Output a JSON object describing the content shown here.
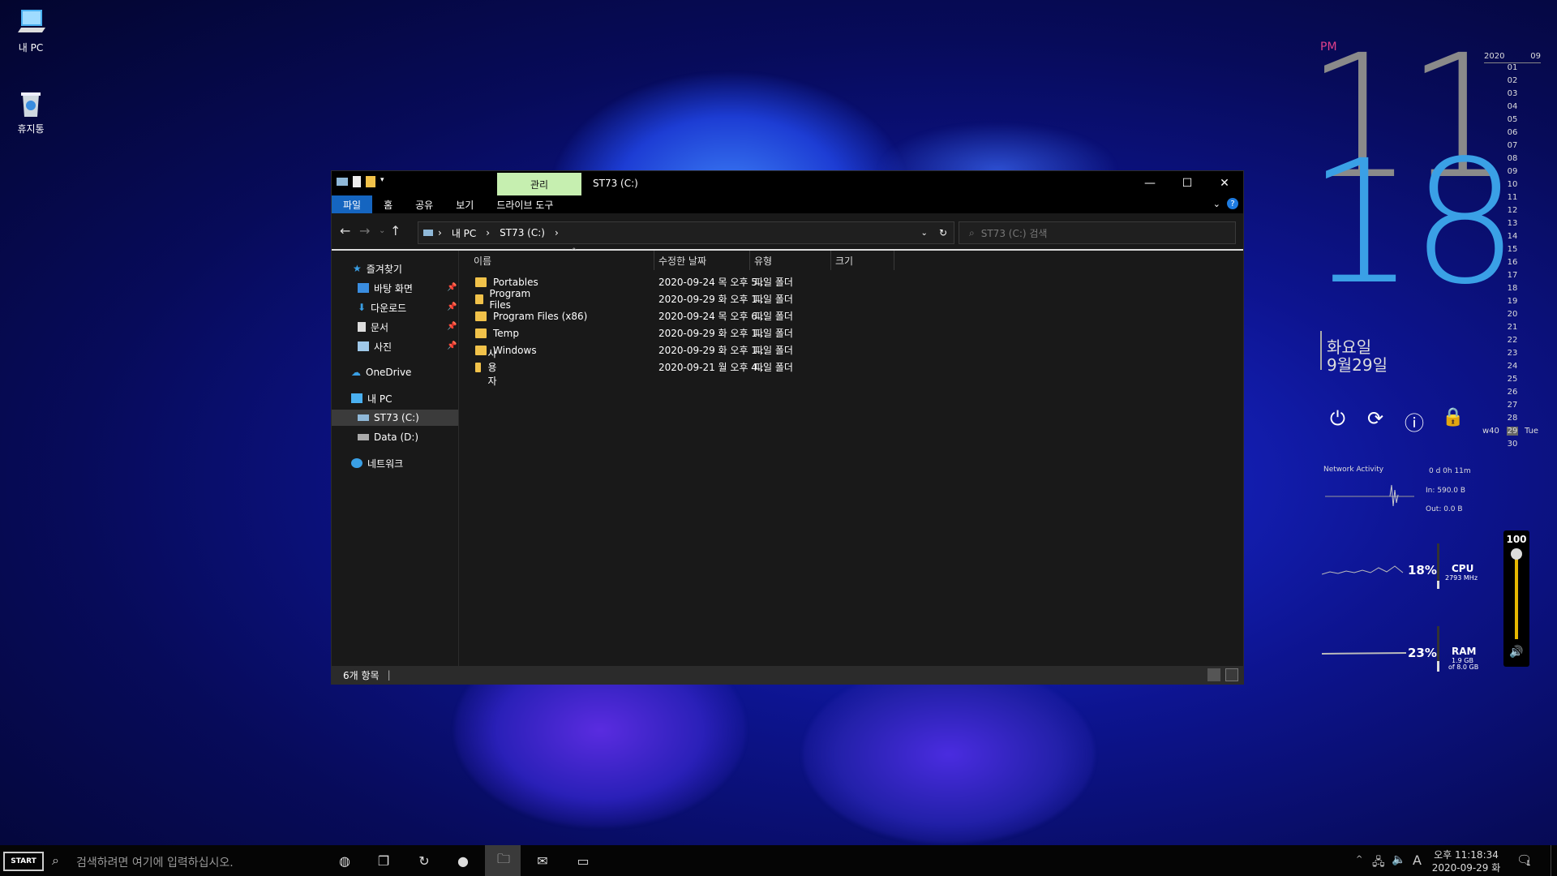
{
  "desktop": {
    "icons": [
      {
        "label": "내 PC",
        "icon": "computer-icon"
      },
      {
        "label": "휴지통",
        "icon": "recycle-bin-icon"
      }
    ]
  },
  "explorer": {
    "title": "ST73 (C:)",
    "context_tab": "관리",
    "ribbon_tabs": [
      "파일",
      "홈",
      "공유",
      "보기",
      "드라이브 도구"
    ],
    "address": {
      "crumbs": [
        "내 PC",
        "ST73 (C:)"
      ]
    },
    "search_placeholder": "ST73 (C:) 검색",
    "nav": {
      "quick_access": "즐겨찾기",
      "pinned": [
        "바탕 화면",
        "다운로드",
        "문서",
        "사진"
      ],
      "onedrive": "OneDrive",
      "this_pc": "내 PC",
      "drives": [
        "ST73 (C:)",
        "Data (D:)"
      ],
      "network": "네트워크"
    },
    "columns": [
      "이름",
      "수정한 날짜",
      "유형",
      "크기"
    ],
    "rows": [
      {
        "name": "Portables",
        "date": "2020-09-24 목 오후 5...",
        "type": "파일 폴더"
      },
      {
        "name": "Program Files",
        "date": "2020-09-29 화 오후 1...",
        "type": "파일 폴더"
      },
      {
        "name": "Program Files (x86)",
        "date": "2020-09-24 목 오후 6...",
        "type": "파일 폴더"
      },
      {
        "name": "Temp",
        "date": "2020-09-29 화 오후 1...",
        "type": "파일 폴더"
      },
      {
        "name": "Windows",
        "date": "2020-09-29 화 오후 1...",
        "type": "파일 폴더"
      },
      {
        "name": "사용자",
        "date": "2020-09-21 월 오후 4...",
        "type": "파일 폴더"
      }
    ],
    "status": "6개 항목"
  },
  "clock": {
    "ampm": "PM",
    "hour": "11",
    "minute": "18",
    "weekday": "화요일",
    "date": "9월29일"
  },
  "calendar": {
    "year": "2020",
    "month": "09",
    "days": [
      "01",
      "02",
      "03",
      "04",
      "05",
      "06",
      "07",
      "08",
      "09",
      "10",
      "11",
      "12",
      "13",
      "14",
      "15",
      "16",
      "17",
      "18",
      "19",
      "20",
      "21",
      "22",
      "23",
      "24",
      "25",
      "26",
      "27",
      "28",
      "29",
      "30"
    ],
    "week": "w40",
    "today": "29",
    "today_dow": "Tue"
  },
  "network": {
    "title": "Network Activity",
    "uptime": "0 d 0h 11m",
    "in": "In: 590.0 B",
    "out": "Out: 0.0 B"
  },
  "cpu": {
    "percent": "18%",
    "label": "CPU",
    "freq": "2793 MHz"
  },
  "ram": {
    "percent": "23%",
    "label": "RAM",
    "used": "1.9 GB",
    "total": "of 8.0 GB"
  },
  "volume": {
    "level": "100",
    "value": 1.0
  },
  "taskbar": {
    "start_label": "START",
    "search_placeholder": "검색하려면 여기에 입력하십시오.",
    "ime": "A",
    "time": "오후 11:18:34",
    "date": "2020-09-29 화",
    "notification_count": "1"
  },
  "colors": {
    "accent_blue": "#1565c0",
    "clock_gray": "#8a8a8a",
    "clock_blue": "#3aa0e6",
    "pm_pink": "#e0408a",
    "context_tab": "#c6efb0",
    "folder": "#f1c24a"
  }
}
